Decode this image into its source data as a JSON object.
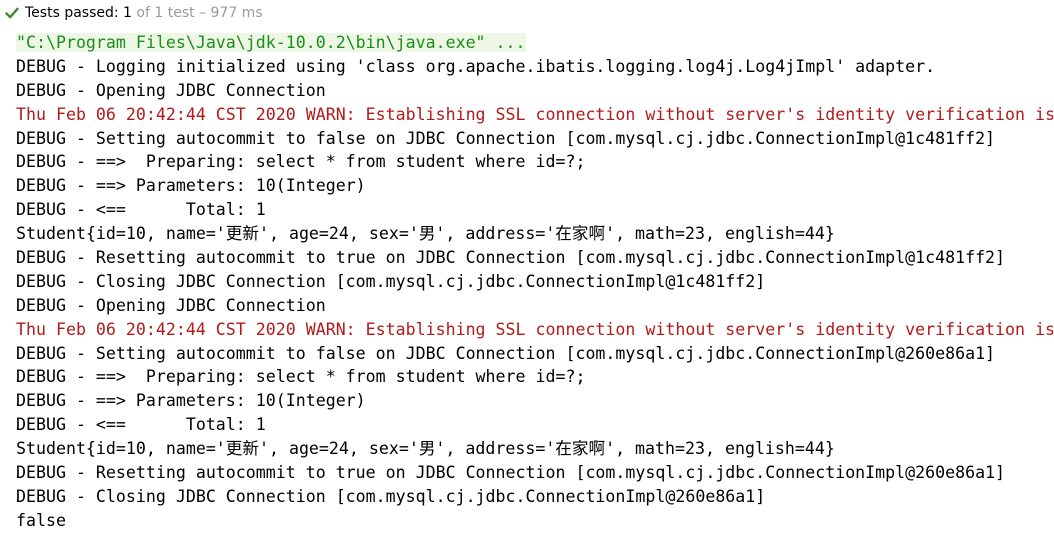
{
  "status": {
    "label": "Tests passed:",
    "passed": "1",
    "detail": "of 1 test – 977 ms",
    "icon": "check-icon",
    "icon_color": "#3d8b2e"
  },
  "console": {
    "colors": {
      "normal": "#000000",
      "command": "#1a8f1a",
      "warning": "#b31b1b"
    },
    "lines": [
      {
        "type": "cmd",
        "text": "\"C:\\Program Files\\Java\\jdk-10.0.2\\bin\\java.exe\" ..."
      },
      {
        "type": "normal",
        "text": "DEBUG - Logging initialized using 'class org.apache.ibatis.logging.log4j.Log4jImpl' adapter."
      },
      {
        "type": "normal",
        "text": "DEBUG - Opening JDBC Connection"
      },
      {
        "type": "warn",
        "text": "Thu Feb 06 20:42:44 CST 2020 WARN: Establishing SSL connection without server's identity verification is"
      },
      {
        "type": "normal",
        "text": "DEBUG - Setting autocommit to false on JDBC Connection [com.mysql.cj.jdbc.ConnectionImpl@1c481ff2]"
      },
      {
        "type": "normal",
        "text": "DEBUG - ==>  Preparing: select * from student where id=?;"
      },
      {
        "type": "normal",
        "text": "DEBUG - ==> Parameters: 10(Integer)"
      },
      {
        "type": "normal",
        "text": "DEBUG - <==      Total: 1"
      },
      {
        "type": "normal",
        "text": "Student{id=10, name='更新', age=24, sex='男', address='在家啊', math=23, english=44}"
      },
      {
        "type": "normal",
        "text": "DEBUG - Resetting autocommit to true on JDBC Connection [com.mysql.cj.jdbc.ConnectionImpl@1c481ff2]"
      },
      {
        "type": "normal",
        "text": "DEBUG - Closing JDBC Connection [com.mysql.cj.jdbc.ConnectionImpl@1c481ff2]"
      },
      {
        "type": "normal",
        "text": "DEBUG - Opening JDBC Connection"
      },
      {
        "type": "warn",
        "text": "Thu Feb 06 20:42:44 CST 2020 WARN: Establishing SSL connection without server's identity verification is"
      },
      {
        "type": "normal",
        "text": "DEBUG - Setting autocommit to false on JDBC Connection [com.mysql.cj.jdbc.ConnectionImpl@260e86a1]"
      },
      {
        "type": "normal",
        "text": "DEBUG - ==>  Preparing: select * from student where id=?;"
      },
      {
        "type": "normal",
        "text": "DEBUG - ==> Parameters: 10(Integer)"
      },
      {
        "type": "normal",
        "text": "DEBUG - <==      Total: 1"
      },
      {
        "type": "normal",
        "text": "Student{id=10, name='更新', age=24, sex='男', address='在家啊', math=23, english=44}"
      },
      {
        "type": "normal",
        "text": "DEBUG - Resetting autocommit to true on JDBC Connection [com.mysql.cj.jdbc.ConnectionImpl@260e86a1]"
      },
      {
        "type": "normal",
        "text": "DEBUG - Closing JDBC Connection [com.mysql.cj.jdbc.ConnectionImpl@260e86a1]"
      },
      {
        "type": "normal",
        "text": "false"
      }
    ]
  }
}
